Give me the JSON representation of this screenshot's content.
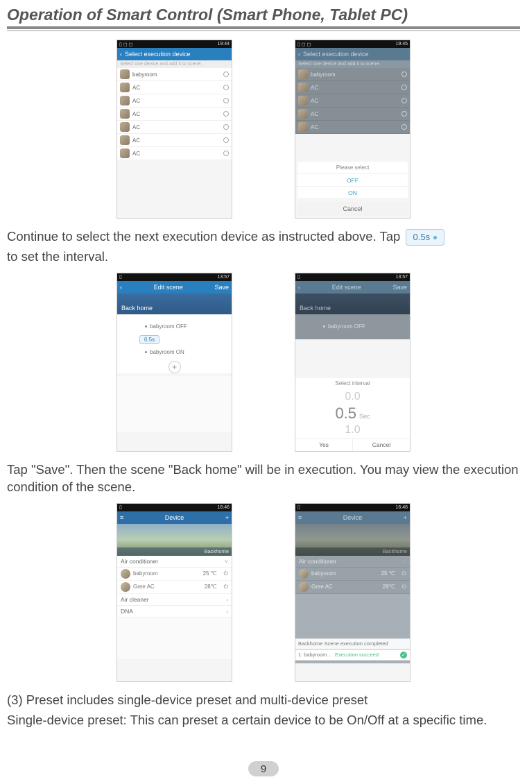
{
  "section_title": "Operation of Smart Control (Smart Phone, Tablet PC)",
  "page_number": "9",
  "para1_a": "Continue to select the next execution device as instructed above. Tap ",
  "interval_chip_label": "0.5s",
  "para1_b": "to set the interval.",
  "para2": "Tap \"Save\". Then the scene \"Back home\" will be in execution. You may view the execution condition of the scene.",
  "para3": "(3) Preset includes single-device preset and multi-device preset",
  "para4": "Single-device preset: This can preset a certain device to be On/Off at a specific time.",
  "screens": {
    "row1_left": {
      "status_time": "19:44",
      "appbar_title": "Select execution device",
      "hint": "Select one device and add it to scene.",
      "devices": [
        "babyroom",
        "AC",
        "AC",
        "AC",
        "AC",
        "AC",
        "AC"
      ]
    },
    "row1_right": {
      "status_time": "19:45",
      "appbar_title": "Select execution device",
      "hint": "Select one device and add it to scene.",
      "devices": [
        "babyroom",
        "AC",
        "AC",
        "AC",
        "AC"
      ],
      "popup": {
        "title": "Please select",
        "options": [
          "OFF",
          "ON"
        ],
        "cancel": "Cancel"
      }
    },
    "row2_left": {
      "status_time": "13:57",
      "appbar_title": "Edit scene",
      "appbar_action": "Save",
      "banner_label": "Back home",
      "actions": [
        "babyroom OFF",
        "babyroom ON"
      ],
      "interval_chip": "0.5s",
      "add_label": "+"
    },
    "row2_right": {
      "status_time": "13:57",
      "appbar_title": "Edit scene",
      "appbar_action": "Save",
      "banner_label": "Back home",
      "actions_dim": [
        "babyroom OFF"
      ],
      "picker": {
        "title": "Select interval",
        "values": [
          "0.0",
          "0.5",
          "1.0"
        ],
        "unit": "Sec",
        "yes": "Yes",
        "cancel": "Cancel"
      }
    },
    "row3_left": {
      "status_time": "16:46",
      "appbar_title": "Device",
      "run_banner": "Backhome",
      "rows": [
        {
          "type": "cat",
          "label": "Air conditioner",
          "chev": "˅"
        },
        {
          "type": "dev",
          "label": "babyroom",
          "temp": "25 ℃"
        },
        {
          "type": "dev",
          "label": "Gree AC",
          "temp": "28℃"
        },
        {
          "type": "cat",
          "label": "Air cleaner",
          "chev": "›"
        },
        {
          "type": "cat",
          "label": "DNA",
          "chev": "›"
        }
      ]
    },
    "row3_right": {
      "status_time": "16:46",
      "appbar_title": "Device",
      "run_banner": "Backhome",
      "rows": [
        {
          "type": "cat",
          "label": "Air conditioner",
          "chev": "˅"
        },
        {
          "type": "dev",
          "label": "babyroom",
          "temp": "25 ℃"
        },
        {
          "type": "dev",
          "label": "Gree AC",
          "temp": "28℃"
        }
      ],
      "toast_top": "Backhome  Scene execution completed",
      "toast_row": {
        "idx": "1",
        "name": "babyroom…",
        "status": "Execution succeed"
      }
    }
  }
}
